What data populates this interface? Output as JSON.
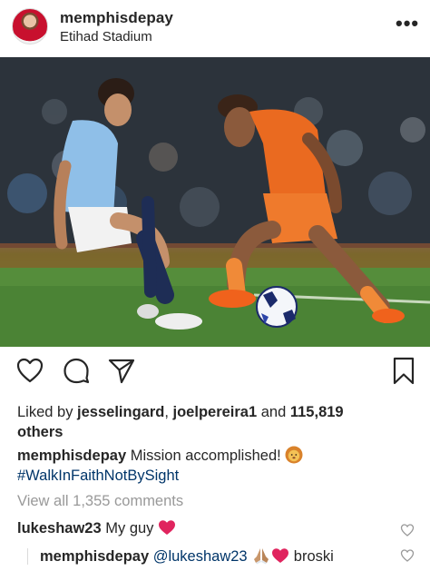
{
  "post": {
    "username": "memphisdepay",
    "location": "Etihad Stadium",
    "more_label": "•••"
  },
  "icons": {
    "like": "heart-outline-icon",
    "comment": "speech-bubble-icon",
    "share": "paper-plane-icon",
    "save": "bookmark-icon"
  },
  "likes": {
    "prefix": "Liked by ",
    "user1": "jesselingard",
    "sep": ", ",
    "user2": "joelpereira1",
    "and": " and ",
    "count": "115,819",
    "suffix": "others"
  },
  "caption": {
    "username": "memphisdepay",
    "text": "Mission accomplished!",
    "hashtag": "#WalkInFaithNotBySight"
  },
  "comments_link": "View all 1,355 comments",
  "comments": [
    {
      "username": "lukeshaw23",
      "text": "My guy"
    },
    {
      "username": "memphisdepay",
      "mention": "@lukeshaw23",
      "text": "broski"
    }
  ],
  "colors": {
    "text": "#262626",
    "muted": "#999999",
    "link": "#003569",
    "heart_emoji": "#e0245e"
  }
}
